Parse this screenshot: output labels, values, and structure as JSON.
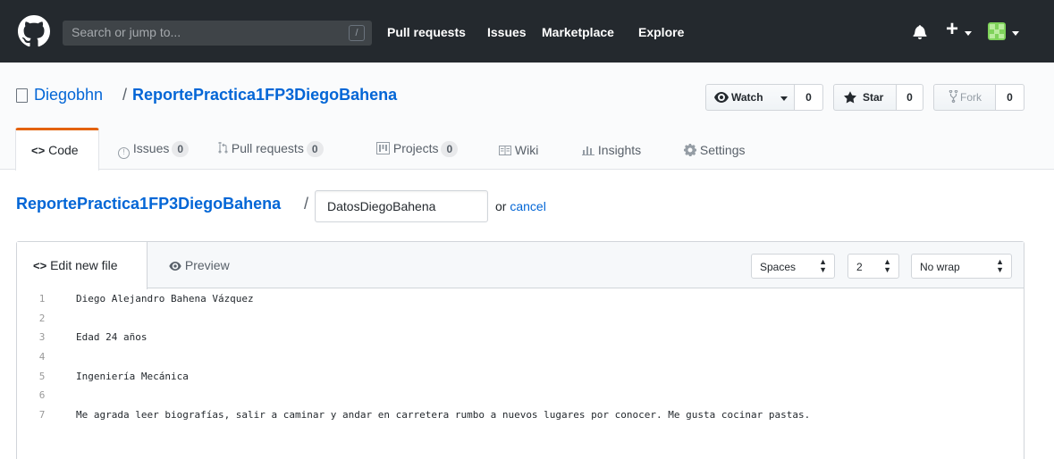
{
  "header": {
    "search_placeholder": "Search or jump to...",
    "search_shortcut": "/",
    "nav": [
      "Pull requests",
      "Issues",
      "Marketplace",
      "Explore"
    ],
    "plus": "+"
  },
  "repo": {
    "owner": "Diegobhn",
    "separator": "/",
    "name": "ReportePractica1FP3DiegoBahena",
    "watch_label": "Watch",
    "watch_count": "0",
    "star_label": "Star",
    "star_count": "0",
    "fork_label": "Fork",
    "fork_count": "0"
  },
  "tabs": {
    "code": "Code",
    "issues": "Issues",
    "issues_count": "0",
    "pulls": "Pull requests",
    "pulls_count": "0",
    "projects": "Projects",
    "projects_count": "0",
    "wiki": "Wiki",
    "insights": "Insights",
    "settings": "Settings"
  },
  "breadcrumb": {
    "repo": "ReportePractica1FP3DiegoBahena",
    "slash": "/",
    "filename_value": "DatosDiegoBahena",
    "or_text": "or",
    "cancel": "cancel"
  },
  "editor": {
    "tab_edit": "Edit new file",
    "tab_preview": "Preview",
    "indent_mode": "Spaces",
    "indent_size": "2",
    "wrap_mode": "No wrap",
    "lines": [
      {
        "n": "1",
        "text": "Diego Alejandro Bahena Vázquez"
      },
      {
        "n": "2",
        "text": ""
      },
      {
        "n": "3",
        "text": "Edad 24 años"
      },
      {
        "n": "4",
        "text": ""
      },
      {
        "n": "5",
        "text": "Ingeniería Mecánica"
      },
      {
        "n": "6",
        "text": ""
      },
      {
        "n": "7",
        "text": "Me agrada leer biografías, salir a caminar y andar en carretera rumbo a nuevos lugares por conocer. Me gusta cocinar pastas."
      }
    ]
  },
  "colors": {
    "header_bg": "#24292e",
    "link": "#0366d6",
    "selected_tab_border": "#e36209"
  }
}
